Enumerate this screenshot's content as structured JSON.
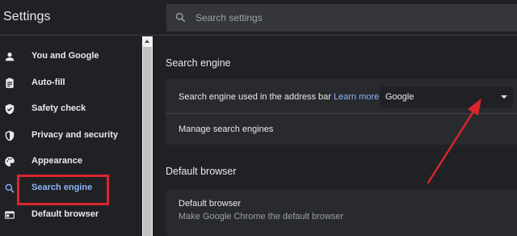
{
  "header": {
    "title": "Settings",
    "search_placeholder": "Search settings",
    "search_icon": "search-icon"
  },
  "sidebar": {
    "items": [
      {
        "label": "You and Google",
        "icon": "person-icon"
      },
      {
        "label": "Auto-fill",
        "icon": "clipboard-icon"
      },
      {
        "label": "Safety check",
        "icon": "shield-check-icon"
      },
      {
        "label": "Privacy and security",
        "icon": "shield-icon"
      },
      {
        "label": "Appearance",
        "icon": "palette-icon"
      },
      {
        "label": "Search engine",
        "icon": "search-icon",
        "active": true
      },
      {
        "label": "Default browser",
        "icon": "browser-icon"
      }
    ]
  },
  "main": {
    "search_engine": {
      "title": "Search engine",
      "address_bar_label": "Search engine used in the address bar",
      "learn_more": "Learn more",
      "selected_engine": "Google",
      "manage_label": "Manage search engines"
    },
    "default_browser": {
      "title": "Default browser",
      "row_title": "Default browser",
      "row_subtitle": "Make Google Chrome the default browser"
    }
  },
  "colors": {
    "background": "#202124",
    "card": "#292a2d",
    "accent": "#8ab4f8",
    "annotation_red": "#d9262c"
  }
}
